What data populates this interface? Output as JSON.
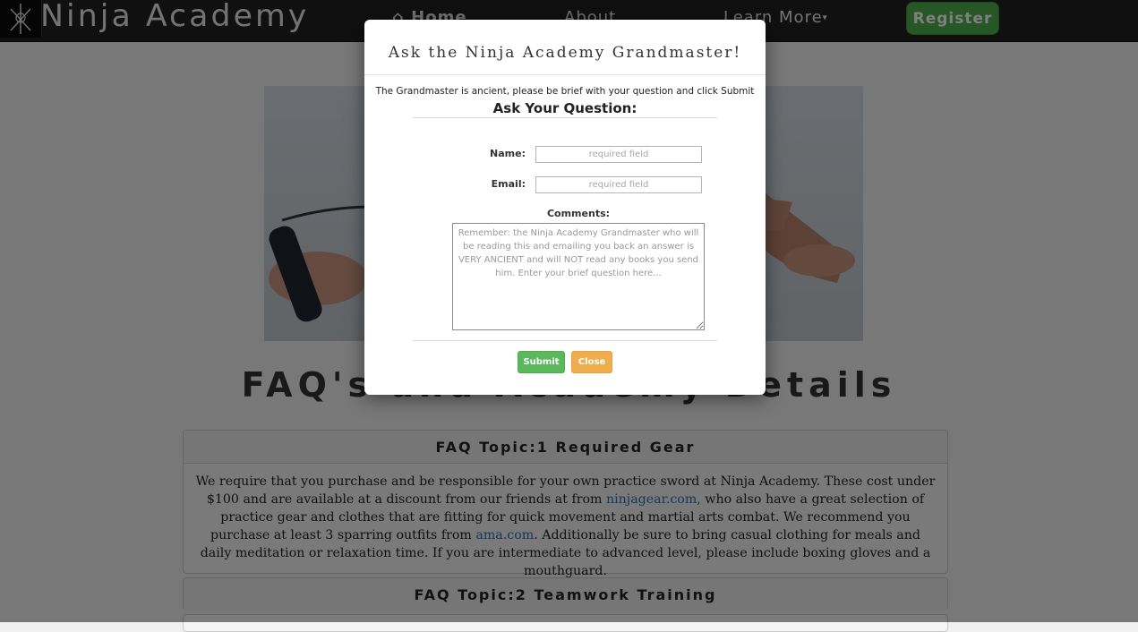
{
  "navbar": {
    "brand": "Ninja Academy",
    "links": [
      {
        "label": "Home"
      },
      {
        "label": "About"
      },
      {
        "label": "Learn More"
      }
    ],
    "register_label": "Register"
  },
  "page": {
    "title": "FAQ's and Academy Details"
  },
  "faq": [
    {
      "heading": "FAQ Topic:1 Required Gear",
      "body_parts": [
        "We require that you purchase and be responsible for your own practice sword at Ninja Academy. These cost under $100 and are available at a discount from our friends at from ",
        "ninjagear.com",
        ", who also have a great selection of practice gear and clothes that are fitting for quick movement and martial arts combat. We recommend you purchase at least 3 sparring outfits from ",
        "ama.com",
        ". Additionally be sure to bring casual clothing for meals and daily meditation or relaxation time. If you are intermediate to advanced level, please include boxing gloves and a mouthguard."
      ]
    },
    {
      "heading": "FAQ Topic:2 Teamwork Training"
    }
  ],
  "modal": {
    "title": "Ask the Ninja Academy Grandmaster!",
    "intro": "The Grandmaster is ancient, please be brief with your question and click Submit",
    "subtitle": "Ask Your Question:",
    "name_label": "Name:",
    "name_placeholder": "required field",
    "email_label": "Email:",
    "email_placeholder": "required field",
    "comments_label": "Comments:",
    "comments_placeholder": "Remember: the Ninja Academy Grandmaster who will be reading this and emailing you back an answer is VERY ANCIENT and will NOT read any books you send him. Enter your brief question here...",
    "submit_label": "Submit",
    "close_label": "Close"
  },
  "colors": {
    "success": "#5cb85c",
    "warning": "#f0ad4e",
    "link": "#2a6fb0",
    "navbar": "#202020"
  }
}
